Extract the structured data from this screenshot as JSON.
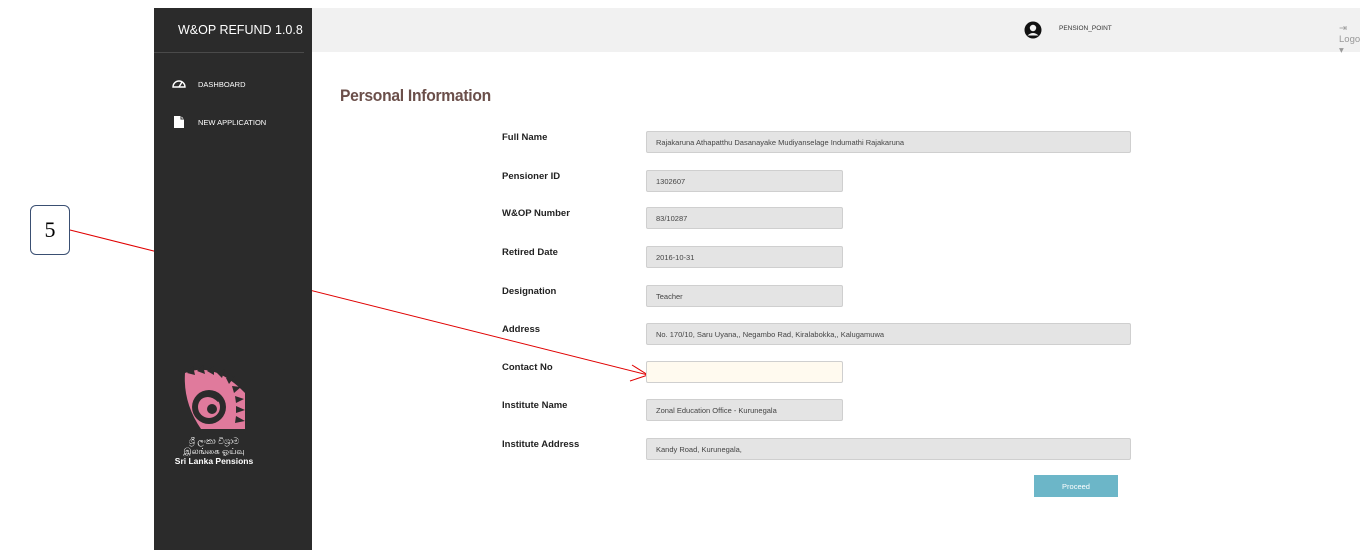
{
  "callout": {
    "number": "5"
  },
  "brand": {
    "title": "W&OP REFUND 1.0.8"
  },
  "sidebar": {
    "items": [
      {
        "label": "DASHBOARD",
        "icon": "dashboard-icon"
      },
      {
        "label": "NEW APPLICATION",
        "icon": "document-icon"
      }
    ],
    "logo": {
      "line1": "ශ්‍රී ලංකා විශ්‍රාම",
      "line2": "இலங்கை ஓய்வு",
      "line3": "Sri Lanka Pensions"
    }
  },
  "topbar": {
    "user_name": "PENSION_POINT",
    "logout_label": "Logout ▾"
  },
  "page": {
    "title": "Personal Information"
  },
  "form": {
    "full_name": {
      "label": "Full Name",
      "value": "Rajakaruna Athapatthu Dasanayake Mudiyanselage Indumathi Rajakaruna"
    },
    "pensioner_id": {
      "label": "Pensioner ID",
      "value": "1302607"
    },
    "wop_number": {
      "label": "W&OP Number",
      "value": "83/10287"
    },
    "retired_date": {
      "label": "Retired Date",
      "value": "2016-10-31"
    },
    "designation": {
      "label": "Designation",
      "value": "Teacher"
    },
    "address": {
      "label": "Address",
      "value": "No. 170/10, Saru Uyana,, Negambo Rad, Kiralabokka,, Kalugamuwa"
    },
    "contact_no": {
      "label": "Contact No",
      "value": ""
    },
    "institute_name": {
      "label": "Institute Name",
      "value": "Zonal Education Office - Kurunegala"
    },
    "institute_address": {
      "label": "Institute Address",
      "value": "Kandy Road, Kurunegala,"
    },
    "proceed_label": "Proceed"
  },
  "colors": {
    "sidebar_bg": "#2b2b2b",
    "topbar_bg": "#f1f1f1",
    "title_color": "#6b4f4a",
    "button_bg": "#6cb6c8",
    "arrow_color": "#e00000"
  }
}
